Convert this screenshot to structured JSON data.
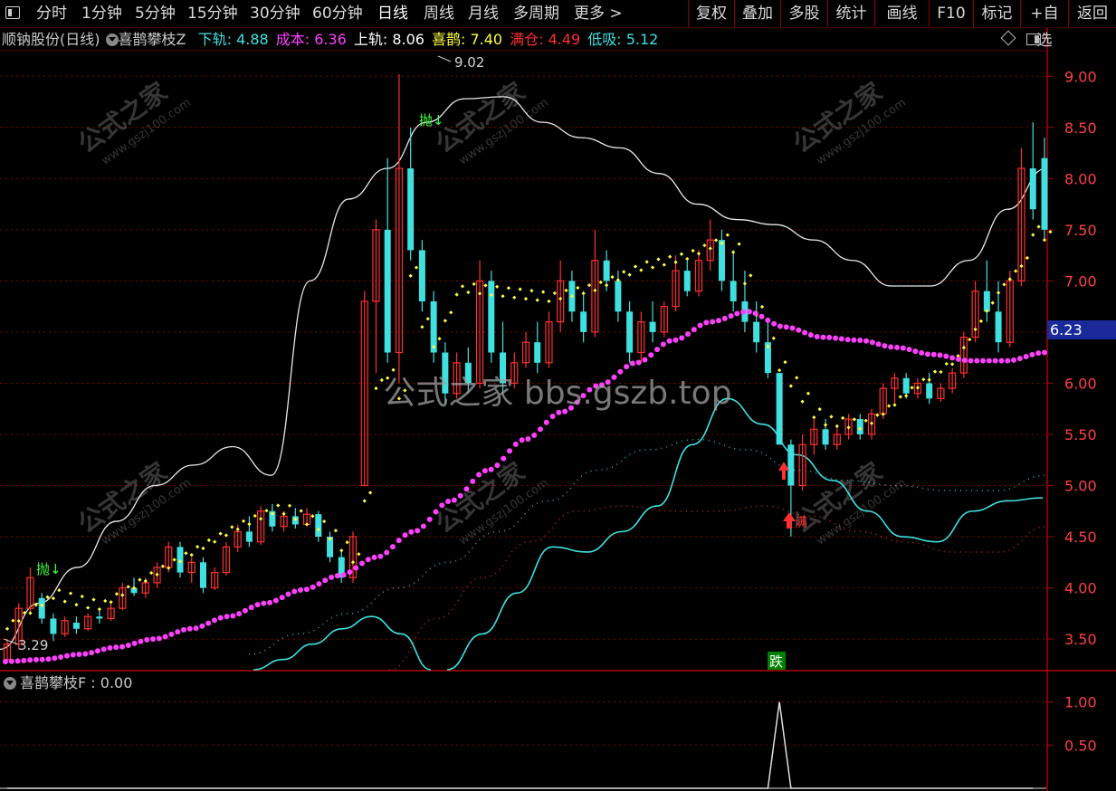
{
  "toolbar": {
    "menu_icon": "menu-square-icon",
    "periods": [
      "分时",
      "1分钟",
      "5分钟",
      "15分钟",
      "30分钟",
      "60分钟",
      "日线",
      "周线",
      "月线",
      "多周期",
      "更多 >"
    ],
    "active_period": "日线",
    "right_buttons": [
      "复权",
      "叠加",
      "多股",
      "统计",
      "画线",
      "F10",
      "标记",
      "+自选",
      "返回"
    ]
  },
  "header": {
    "stock_title": "顺钠股份(日线)",
    "indicator_name": "喜鹊攀枝Z",
    "items": [
      {
        "label": "下轨",
        "value": "4.88",
        "color": "#40e0e0"
      },
      {
        "label": "成本",
        "value": "6.36",
        "color": "#ff40ff"
      },
      {
        "label": "上轨",
        "value": "8.06",
        "color": "#ffffff"
      },
      {
        "label": "喜鹊",
        "value": "7.40",
        "color": "#ffff40"
      },
      {
        "label": "满仓",
        "value": "4.49",
        "color": "#ff3030"
      },
      {
        "label": "低吸",
        "value": "5.12",
        "color": "#40e0e0"
      }
    ]
  },
  "sub_indicator": {
    "name": "喜鹊攀枝F",
    "value": "0.00"
  },
  "watermark": {
    "center_text": "公式之家 bbs.gszb.top",
    "logo_text": "公式之家",
    "logo_url_text": "www.gszj100.com"
  },
  "chart_data": [
    {
      "type": "candlestick",
      "title": "顺钠股份(日线)",
      "y_axis_ticks": [
        9.0,
        8.5,
        8.0,
        7.5,
        7.0,
        6.5,
        6.0,
        5.5,
        5.0,
        4.5,
        4.0,
        3.5
      ],
      "y_axis_labels": [
        "9.00",
        "8.50",
        "8.00",
        "7.50",
        "7.00",
        "6.50",
        "6.00",
        "5.50",
        "5.00",
        "4.50",
        "4.00",
        "3.50"
      ],
      "ylim": [
        3.2,
        9.25
      ],
      "current_price_label": "6.23",
      "high_marker": {
        "label": "9.02"
      },
      "low_marker": {
        "label": "3.29"
      },
      "signals": [
        {
          "text": "抛↓",
          "color": "#40ff40"
        },
        {
          "text": "抛↓",
          "color": "#40ff40"
        },
        {
          "text": "满",
          "color": "#ff3030"
        },
        {
          "text": "跌",
          "color": "#ffffff",
          "bg": "#008000"
        }
      ],
      "colors": {
        "up": "#ff3030",
        "down": "#40e0e0",
        "cost": "#ff40ff",
        "upper": "#e8e8e8",
        "lower": "#40e0e0",
        "magpie": "#ffff40",
        "full": "#ff3030",
        "grid": "#8b0000"
      },
      "series": [
        {
          "name": "成本",
          "values": [
            3.28,
            3.3,
            3.35,
            3.42,
            3.5,
            3.6,
            3.72,
            3.85,
            3.98,
            4.12,
            4.3,
            4.55,
            4.85,
            5.15,
            5.45,
            5.72,
            5.98,
            6.2,
            6.42,
            6.6,
            6.7,
            6.55,
            6.45,
            6.42,
            6.35,
            6.28,
            6.22,
            6.22,
            6.3
          ]
        },
        {
          "name": "上轨",
          "values": [
            3.4,
            3.85,
            4.2,
            4.65,
            5.0,
            5.2,
            5.38,
            5.1,
            7.0,
            7.8,
            8.1,
            8.55,
            8.78,
            8.8,
            8.55,
            8.4,
            8.3,
            8.05,
            7.75,
            7.6,
            7.55,
            7.4,
            7.2,
            6.95,
            6.95,
            7.2,
            7.7,
            8.1
          ]
        },
        {
          "name": "下轨",
          "values": [
            3.15,
            3.28,
            3.4,
            3.55,
            3.7,
            3.58,
            3.2,
            3.4,
            3.85,
            4.35,
            4.4,
            4.35,
            4.55,
            4.8,
            5.35,
            5.8,
            5.65,
            5.2,
            4.9,
            4.6,
            4.45,
            4.6,
            4.8,
            4.88
          ]
        },
        {
          "name": "喜鹊",
          "values": [
            3.6,
            3.9,
            3.78,
            4.05,
            4.3,
            4.55,
            4.75,
            4.55,
            4.1,
            5.9,
            6.9,
            6.85,
            6.8,
            6.9,
            7.1,
            7.2,
            7.4,
            6.2,
            5.6,
            5.55,
            5.9,
            6.2,
            6.9,
            7.4
          ]
        }
      ],
      "candles": [
        {
          "o": 3.3,
          "h": 3.5,
          "l": 3.29,
          "c": 3.45
        },
        {
          "o": 3.45,
          "h": 3.85,
          "l": 3.4,
          "c": 3.8
        },
        {
          "o": 3.8,
          "h": 4.2,
          "l": 3.75,
          "c": 4.1
        },
        {
          "o": 3.9,
          "h": 3.95,
          "l": 3.65,
          "c": 3.7
        },
        {
          "o": 3.7,
          "h": 3.75,
          "l": 3.48,
          "c": 3.55
        },
        {
          "o": 3.55,
          "h": 3.72,
          "l": 3.52,
          "c": 3.68
        },
        {
          "o": 3.66,
          "h": 3.72,
          "l": 3.55,
          "c": 3.6
        },
        {
          "o": 3.6,
          "h": 3.75,
          "l": 3.58,
          "c": 3.72
        },
        {
          "o": 3.72,
          "h": 3.8,
          "l": 3.65,
          "c": 3.7
        },
        {
          "o": 3.7,
          "h": 3.85,
          "l": 3.68,
          "c": 3.8
        },
        {
          "o": 3.8,
          "h": 4.05,
          "l": 3.78,
          "c": 4.0
        },
        {
          "o": 4.0,
          "h": 4.1,
          "l": 3.92,
          "c": 3.95
        },
        {
          "o": 3.95,
          "h": 4.1,
          "l": 3.9,
          "c": 4.05
        },
        {
          "o": 4.05,
          "h": 4.25,
          "l": 4.0,
          "c": 4.2
        },
        {
          "o": 4.2,
          "h": 4.45,
          "l": 4.15,
          "c": 4.4
        },
        {
          "o": 4.4,
          "h": 4.45,
          "l": 4.1,
          "c": 4.15
        },
        {
          "o": 4.15,
          "h": 4.3,
          "l": 4.05,
          "c": 4.25
        },
        {
          "o": 4.25,
          "h": 4.3,
          "l": 3.95,
          "c": 4.0
        },
        {
          "o": 4.0,
          "h": 4.2,
          "l": 3.98,
          "c": 4.15
        },
        {
          "o": 4.15,
          "h": 4.45,
          "l": 4.12,
          "c": 4.4
        },
        {
          "o": 4.4,
          "h": 4.62,
          "l": 4.35,
          "c": 4.55
        },
        {
          "o": 4.55,
          "h": 4.7,
          "l": 4.4,
          "c": 4.45
        },
        {
          "o": 4.45,
          "h": 4.8,
          "l": 4.42,
          "c": 4.75
        },
        {
          "o": 4.75,
          "h": 4.82,
          "l": 4.55,
          "c": 4.6
        },
        {
          "o": 4.6,
          "h": 4.75,
          "l": 4.55,
          "c": 4.7
        },
        {
          "o": 4.7,
          "h": 4.78,
          "l": 4.58,
          "c": 4.62
        },
        {
          "o": 4.62,
          "h": 4.78,
          "l": 4.6,
          "c": 4.72
        },
        {
          "o": 4.72,
          "h": 4.75,
          "l": 4.45,
          "c": 4.5
        },
        {
          "o": 4.5,
          "h": 4.55,
          "l": 4.25,
          "c": 4.3
        },
        {
          "o": 4.3,
          "h": 4.35,
          "l": 4.05,
          "c": 4.1
        },
        {
          "o": 4.1,
          "h": 4.55,
          "l": 4.05,
          "c": 4.5
        },
        {
          "o": 5.0,
          "h": 6.9,
          "l": 5.0,
          "c": 6.8
        },
        {
          "o": 6.8,
          "h": 7.6,
          "l": 6.1,
          "c": 7.5
        },
        {
          "o": 7.5,
          "h": 8.2,
          "l": 6.2,
          "c": 6.3
        },
        {
          "o": 6.3,
          "h": 9.02,
          "l": 6.0,
          "c": 8.1
        },
        {
          "o": 8.1,
          "h": 8.5,
          "l": 7.2,
          "c": 7.3
        },
        {
          "o": 7.3,
          "h": 7.4,
          "l": 6.7,
          "c": 6.8
        },
        {
          "o": 6.8,
          "h": 6.9,
          "l": 6.2,
          "c": 6.3
        },
        {
          "o": 6.3,
          "h": 6.4,
          "l": 5.8,
          "c": 5.9
        },
        {
          "o": 5.9,
          "h": 6.3,
          "l": 5.85,
          "c": 6.2
        },
        {
          "o": 6.2,
          "h": 6.35,
          "l": 5.9,
          "c": 6.0
        },
        {
          "o": 6.0,
          "h": 7.2,
          "l": 5.95,
          "c": 7.0
        },
        {
          "o": 7.0,
          "h": 7.1,
          "l": 6.2,
          "c": 6.3
        },
        {
          "o": 6.3,
          "h": 6.6,
          "l": 5.9,
          "c": 6.0
        },
        {
          "o": 6.0,
          "h": 6.3,
          "l": 5.95,
          "c": 6.2
        },
        {
          "o": 6.2,
          "h": 6.5,
          "l": 6.15,
          "c": 6.4
        },
        {
          "o": 6.4,
          "h": 6.6,
          "l": 6.1,
          "c": 6.2
        },
        {
          "o": 6.2,
          "h": 6.7,
          "l": 6.15,
          "c": 6.6
        },
        {
          "o": 6.6,
          "h": 7.2,
          "l": 6.5,
          "c": 7.0
        },
        {
          "o": 7.0,
          "h": 7.1,
          "l": 6.6,
          "c": 6.7
        },
        {
          "o": 6.7,
          "h": 6.9,
          "l": 6.4,
          "c": 6.5
        },
        {
          "o": 6.5,
          "h": 7.5,
          "l": 6.45,
          "c": 7.2
        },
        {
          "o": 7.2,
          "h": 7.3,
          "l": 6.9,
          "c": 7.0
        },
        {
          "o": 7.0,
          "h": 7.1,
          "l": 6.6,
          "c": 6.7
        },
        {
          "o": 6.7,
          "h": 6.8,
          "l": 6.2,
          "c": 6.3
        },
        {
          "o": 6.3,
          "h": 6.7,
          "l": 6.2,
          "c": 6.6
        },
        {
          "o": 6.6,
          "h": 6.8,
          "l": 6.4,
          "c": 6.5
        },
        {
          "o": 6.5,
          "h": 6.8,
          "l": 6.45,
          "c": 6.75
        },
        {
          "o": 6.75,
          "h": 7.25,
          "l": 6.7,
          "c": 7.1
        },
        {
          "o": 7.1,
          "h": 7.2,
          "l": 6.85,
          "c": 6.9
        },
        {
          "o": 6.9,
          "h": 7.3,
          "l": 6.85,
          "c": 7.2
        },
        {
          "o": 7.2,
          "h": 7.6,
          "l": 7.1,
          "c": 7.4
        },
        {
          "o": 7.4,
          "h": 7.5,
          "l": 6.9,
          "c": 7.0
        },
        {
          "o": 7.0,
          "h": 7.3,
          "l": 6.7,
          "c": 6.8
        },
        {
          "o": 6.8,
          "h": 7.1,
          "l": 6.5,
          "c": 6.6
        },
        {
          "o": 6.6,
          "h": 6.8,
          "l": 6.3,
          "c": 6.4
        },
        {
          "o": 6.4,
          "h": 6.6,
          "l": 6.05,
          "c": 6.1
        },
        {
          "o": 6.1,
          "h": 5.9,
          "l": 5.4,
          "c": 5.4
        },
        {
          "o": 5.4,
          "h": 5.45,
          "l": 4.5,
          "c": 5.0
        },
        {
          "o": 5.0,
          "h": 5.5,
          "l": 4.95,
          "c": 5.4
        },
        {
          "o": 5.4,
          "h": 5.65,
          "l": 5.3,
          "c": 5.55
        },
        {
          "o": 5.55,
          "h": 5.65,
          "l": 5.35,
          "c": 5.4
        },
        {
          "o": 5.4,
          "h": 5.6,
          "l": 5.35,
          "c": 5.5
        },
        {
          "o": 5.5,
          "h": 5.7,
          "l": 5.45,
          "c": 5.65
        },
        {
          "o": 5.65,
          "h": 5.7,
          "l": 5.45,
          "c": 5.5
        },
        {
          "o": 5.5,
          "h": 5.75,
          "l": 5.45,
          "c": 5.7
        },
        {
          "o": 5.7,
          "h": 6.0,
          "l": 5.65,
          "c": 5.95
        },
        {
          "o": 5.95,
          "h": 6.1,
          "l": 5.8,
          "c": 6.05
        },
        {
          "o": 6.05,
          "h": 6.1,
          "l": 5.85,
          "c": 5.9
        },
        {
          "o": 5.9,
          "h": 6.05,
          "l": 5.85,
          "c": 6.0
        },
        {
          "o": 6.0,
          "h": 6.1,
          "l": 5.8,
          "c": 5.85
        },
        {
          "o": 5.85,
          "h": 6.0,
          "l": 5.82,
          "c": 5.95
        },
        {
          "o": 5.95,
          "h": 6.15,
          "l": 5.9,
          "c": 6.1
        },
        {
          "o": 6.1,
          "h": 6.5,
          "l": 6.05,
          "c": 6.45
        },
        {
          "o": 6.45,
          "h": 7.0,
          "l": 6.4,
          "c": 6.9
        },
        {
          "o": 6.9,
          "h": 7.2,
          "l": 6.6,
          "c": 6.7
        },
        {
          "o": 6.7,
          "h": 7.0,
          "l": 6.3,
          "c": 6.4
        },
        {
          "o": 6.4,
          "h": 7.1,
          "l": 6.35,
          "c": 7.0
        },
        {
          "o": 7.0,
          "h": 8.3,
          "l": 6.95,
          "c": 8.1
        },
        {
          "o": 8.1,
          "h": 8.55,
          "l": 7.6,
          "c": 7.7
        },
        {
          "o": 8.2,
          "h": 8.4,
          "l": 7.4,
          "c": 7.5
        }
      ]
    },
    {
      "type": "line",
      "title": "喜鹊攀枝F",
      "y_axis_labels": [
        "1.00",
        "0.50"
      ],
      "ylim": [
        0,
        1.1
      ],
      "series": [
        {
          "name": "喜鹊攀枝F",
          "values": [
            0,
            0,
            0,
            0,
            0,
            0,
            0,
            0,
            0,
            0,
            0,
            0,
            0,
            0,
            0,
            0,
            0,
            0,
            0,
            0,
            0,
            0,
            0,
            0,
            0,
            0,
            0,
            0,
            0,
            0,
            0,
            0,
            0,
            0,
            0,
            0,
            0,
            0,
            0,
            0,
            0,
            0,
            0,
            0,
            0,
            0,
            0,
            0,
            0,
            0,
            0,
            0,
            0,
            0,
            0,
            0,
            0,
            0,
            0,
            0,
            0,
            0,
            0,
            0,
            0,
            0,
            0,
            1,
            0,
            0,
            0,
            0,
            0,
            0,
            0,
            0,
            0,
            0,
            0,
            0,
            0,
            0,
            0,
            0,
            0,
            0,
            0,
            0,
            0,
            0
          ]
        }
      ]
    }
  ]
}
